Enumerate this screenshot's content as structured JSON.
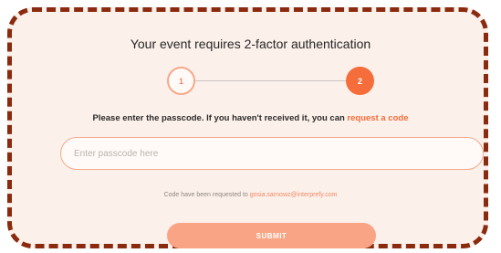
{
  "dialog": {
    "title": "Your event requires 2-factor authentication",
    "steps": [
      "1",
      "2"
    ],
    "instruction": "Please enter the passcode. If you haven't received it, you can ",
    "request_link": "request a code",
    "passcode_placeholder": "Enter passcode here",
    "passcode_value": "",
    "note_prefix": "Code have been requested to ",
    "note_email": "gosia.sarnowz@interprefy.com",
    "submit_label": "SUBMIT"
  },
  "colors": {
    "accent": "#f46d3a",
    "accent_light": "#f9a585",
    "frame_border": "#8a2a0e",
    "background": "#fcf0ea"
  }
}
